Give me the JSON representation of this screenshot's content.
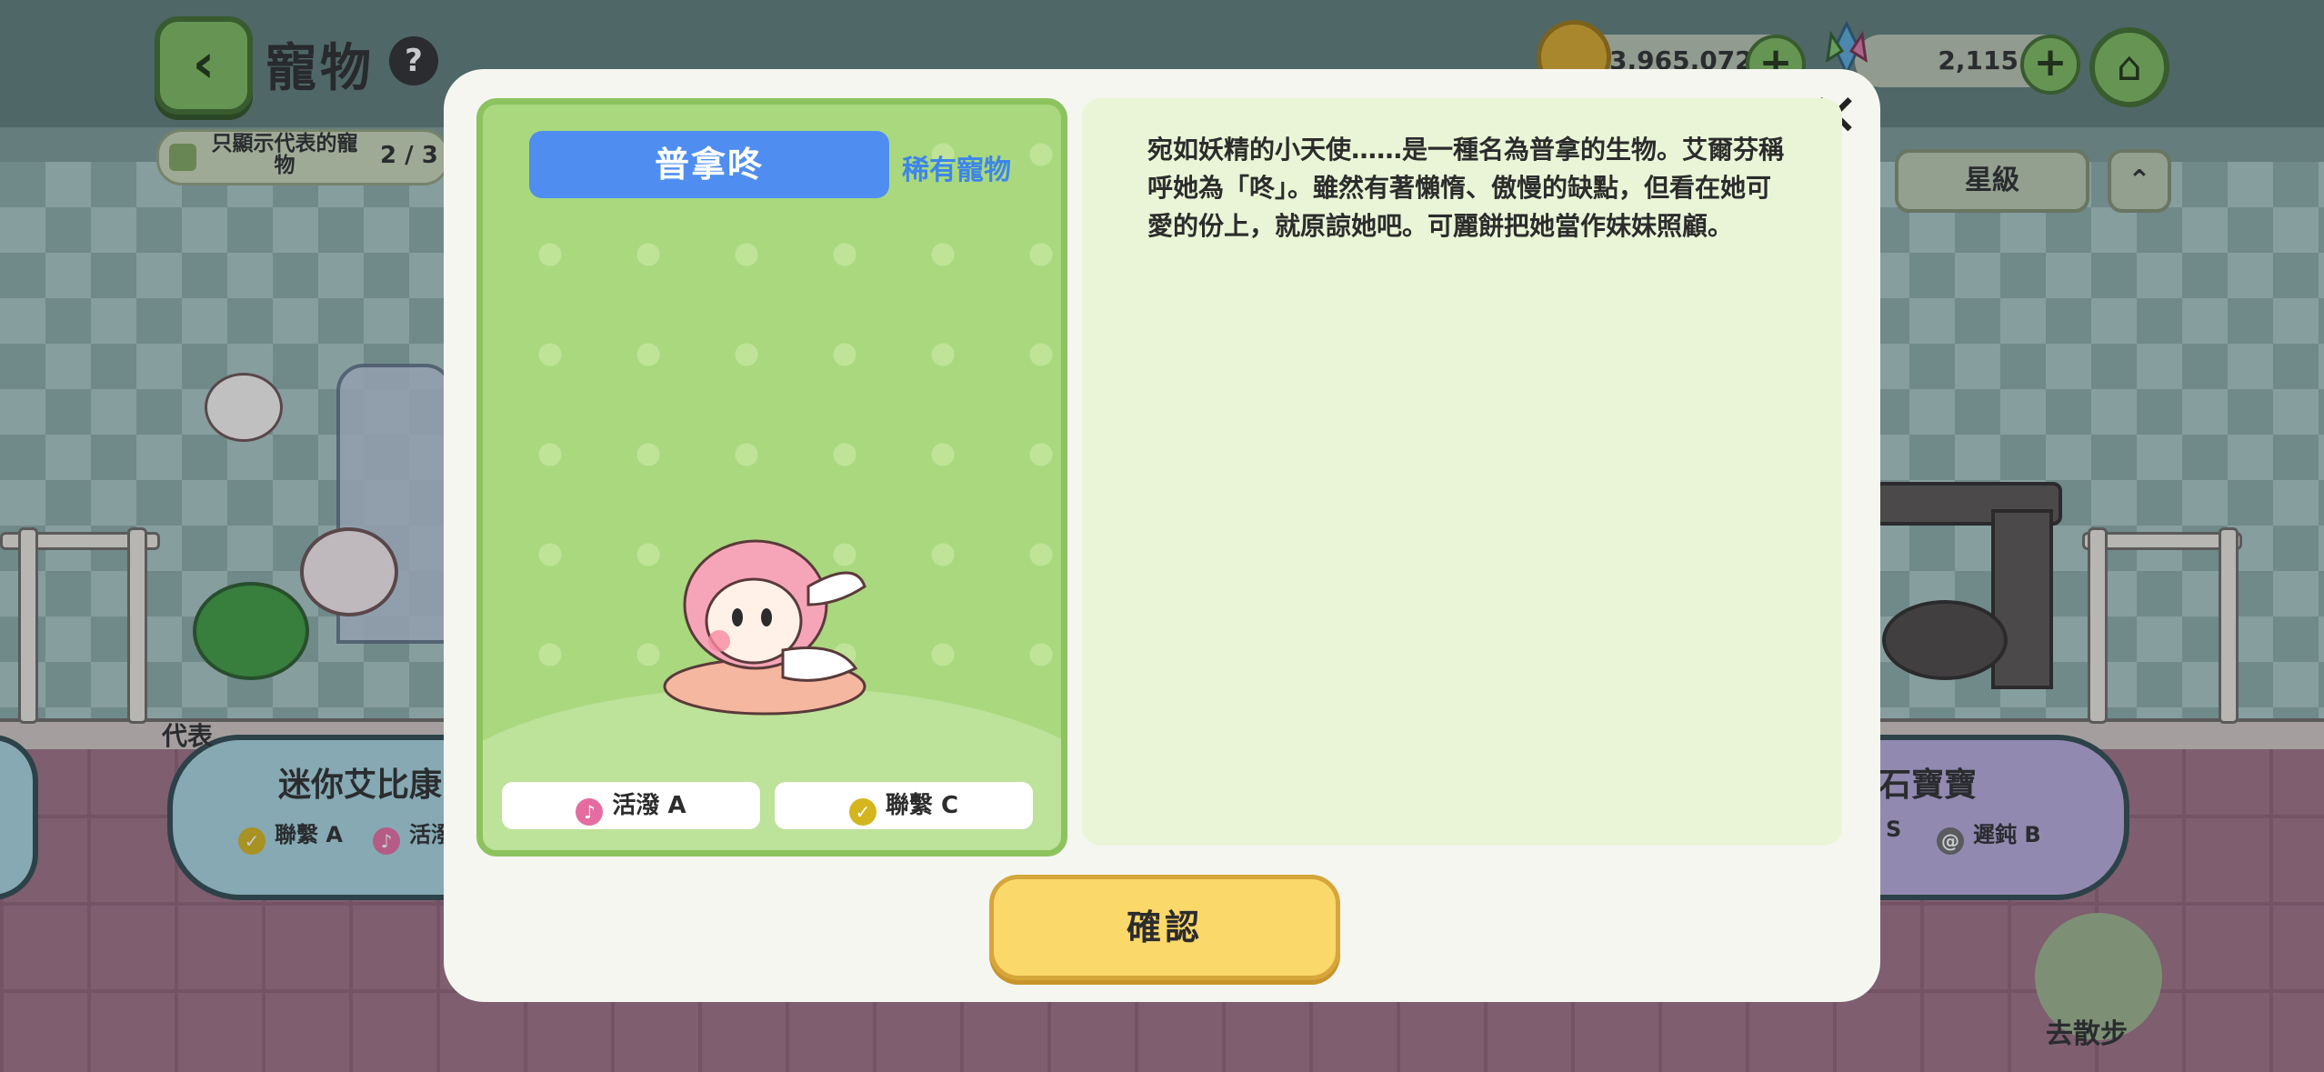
{
  "header": {
    "title": "寵物",
    "help_icon": "help-icon",
    "filter_label": "只顯示代表的寵物",
    "filter_count": "2 / 3"
  },
  "currency": {
    "coins": "3,965,072",
    "gems": "2,115"
  },
  "sort": {
    "label": "星級",
    "direction_icon": "sort-direction-icon"
  },
  "background_cards": {
    "left": {
      "name": "迷你艾比康",
      "trait1": "聯繫 A",
      "trait2": "活潑",
      "tag": "代表"
    },
    "right": {
      "name": "石寶寶",
      "trait1": "S",
      "trait2": "遲鈍 B"
    }
  },
  "walk": {
    "label": "去散步"
  },
  "modal": {
    "pet_name": "普拿咚",
    "rarity": "稀有寵物",
    "traits": [
      {
        "label": "活潑 A",
        "icon": "music-note-icon",
        "color": "#e56ca0"
      },
      {
        "label": "聯繫 C",
        "icon": "check-icon",
        "color": "#d5b51e"
      }
    ],
    "description": "宛如妖精的小天使……是一種名為普拿的生物。艾爾芬稱呼她為「咚」。雖然有著懶惰、傲慢的缺點，但看在她可愛的份上，就原諒她吧。可麗餅把她當作妹妹照顧。",
    "confirm_label": "確認",
    "close_icon": "close-icon"
  },
  "colors": {
    "accent_green": "#7db85c",
    "tab_blue": "#4f8ef0",
    "confirm_yellow": "#fbd86a"
  }
}
